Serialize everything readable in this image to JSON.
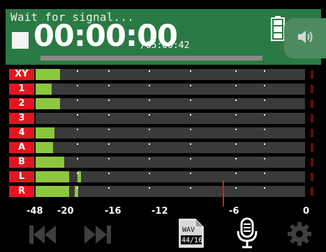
{
  "header": {
    "status": "Wait for signal...",
    "time": "00:00:00",
    "remaining": "/05:00:42",
    "battery_icon": "battery-full-icon",
    "speaker_icon": "speaker-icon"
  },
  "channels": [
    {
      "label": "XY",
      "level": 0.09,
      "peak": null
    },
    {
      "label": "1",
      "level": 0.06,
      "peak": null
    },
    {
      "label": "2",
      "level": 0.09,
      "peak": null
    },
    {
      "label": "3",
      "level": 0.0,
      "peak": null
    },
    {
      "label": "4",
      "level": 0.07,
      "peak": null
    },
    {
      "label": "A",
      "level": 0.065,
      "peak": null
    },
    {
      "label": "B",
      "level": 0.105,
      "peak": null
    },
    {
      "label": "L",
      "level": 0.125,
      "peak": 0.155
    },
    {
      "label": "R",
      "level": 0.125,
      "peak": 0.145
    }
  ],
  "scale": [
    "-48",
    "-20",
    "-16",
    "-12",
    "-6",
    "0"
  ],
  "file_format": {
    "line1": "WAV",
    "line2": "44/16"
  },
  "colors": {
    "header_bg": "#2a7a44",
    "meter_fill": "#8dc63f",
    "label_bg": "#e3161f",
    "track_bg": "#3a3a3a",
    "marker": "#e31b1b"
  },
  "toolbar": {
    "rewind_icon": "skip-back-icon",
    "forward_icon": "skip-forward-icon",
    "file_icon": "file-format-icon",
    "mic_icon": "microphone-icon",
    "settings_icon": "gear-icon"
  }
}
